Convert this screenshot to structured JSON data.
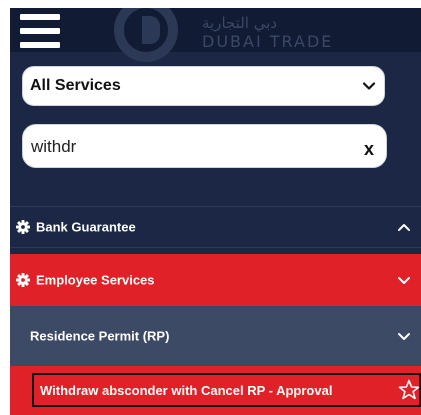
{
  "header": {
    "logo_arabic": "دبي التجارية",
    "logo_english": "DUBAI TRADE"
  },
  "service_filter": {
    "selected": "All Services"
  },
  "search": {
    "value": "withdr",
    "clear_label": "x"
  },
  "menu": {
    "bank_guarantee": "Bank Guarantee",
    "employee_services": "Employee Services",
    "residence_permit": "Residence Permit (RP)"
  },
  "result": {
    "label": "Withdraw absconder with Cancel RP - Approval"
  },
  "colors": {
    "panel": "#1b2744",
    "header": "#111b33",
    "accent_red": "#e02128",
    "submenu": "#3d4a66"
  }
}
